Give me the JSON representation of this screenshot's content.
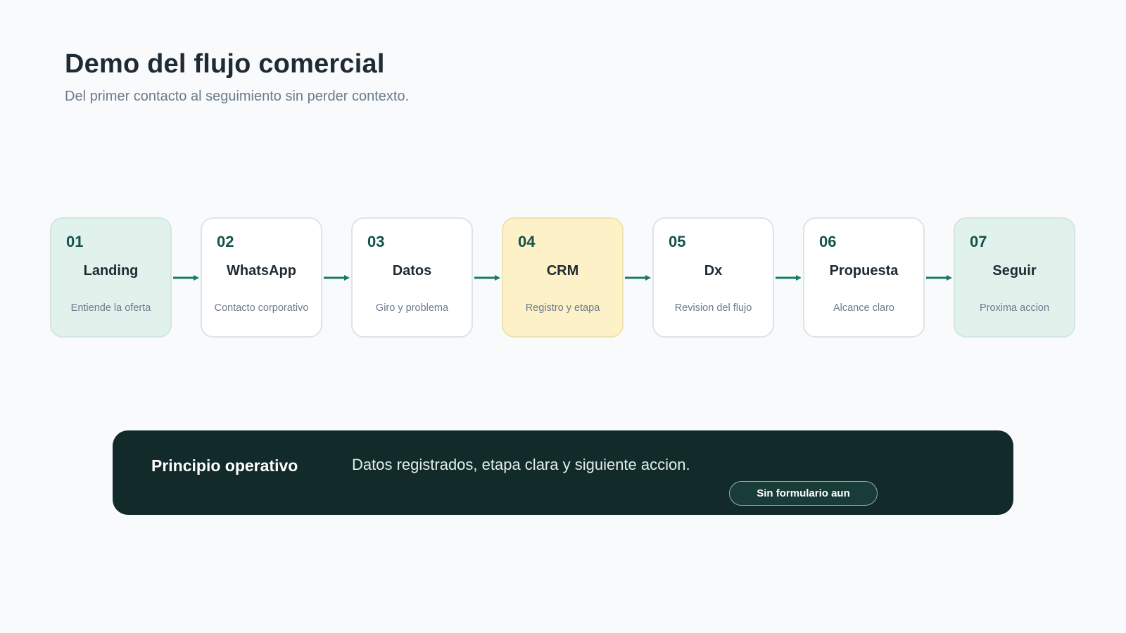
{
  "header": {
    "title": "Demo del flujo comercial",
    "subtitle": "Del primer contacto al seguimiento sin perder contexto."
  },
  "flow": {
    "steps": [
      {
        "number": "01",
        "title": "Landing",
        "description": "Entiende la oferta",
        "tone": "mint"
      },
      {
        "number": "02",
        "title": "WhatsApp",
        "description": "Contacto corporativo",
        "tone": "white"
      },
      {
        "number": "03",
        "title": "Datos",
        "description": "Giro y problema",
        "tone": "white"
      },
      {
        "number": "04",
        "title": "CRM",
        "description": "Registro y etapa",
        "tone": "yellow"
      },
      {
        "number": "05",
        "title": "Dx",
        "description": "Revision del flujo",
        "tone": "white"
      },
      {
        "number": "06",
        "title": "Propuesta",
        "description": "Alcance claro",
        "tone": "white"
      },
      {
        "number": "07",
        "title": "Seguir",
        "description": "Proxima accion",
        "tone": "mint"
      }
    ],
    "arrow_color": "#1a7a6a"
  },
  "banner": {
    "label": "Principio operativo",
    "text": "Datos registrados, etapa clara y siguiente accion.",
    "chip_label": "Sin formulario aun"
  },
  "colors": {
    "background": "#f8fafb",
    "accent_dark": "#122b2a",
    "step_number": "#14524d",
    "mint": "#e1f2ec",
    "yellow": "#fdf1c7"
  }
}
